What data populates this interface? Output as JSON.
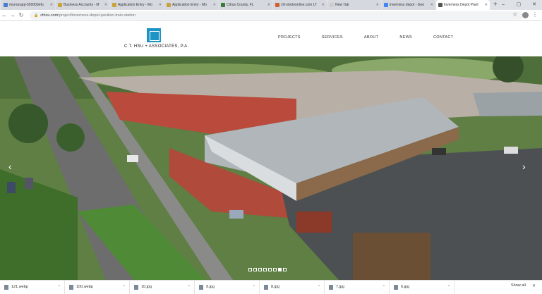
{
  "browser": {
    "tabs": [
      {
        "title": "munozapp-55000defu",
        "icon_color": "#4a7bd0",
        "active": false
      },
      {
        "title": "Business Accounts - M",
        "icon_color": "#c8a23a",
        "active": false
      },
      {
        "title": "Application Entry - Mo",
        "icon_color": "#c8a23a",
        "active": false
      },
      {
        "title": "Application Entry - Mo",
        "icon_color": "#c8a23a",
        "active": false
      },
      {
        "title": "Citrus County, FL",
        "icon_color": "#3a7a3a",
        "active": false
      },
      {
        "title": "chronicleonline.com LT",
        "icon_color": "#d06030",
        "active": false
      },
      {
        "title": "New Tab",
        "icon_color": "#cccccc",
        "active": false
      },
      {
        "title": "inverness depot - Goo",
        "icon_color": "#4285f4",
        "active": false
      },
      {
        "title": "Inverness Depot Pavil",
        "icon_color": "#555555",
        "active": true
      }
    ],
    "new_tab_symbol": "+",
    "window_controls": [
      "–",
      "▢",
      "✕"
    ],
    "url_domain": "cthsu.com",
    "url_path": "/project/inverness-depot-pavilion-train-station"
  },
  "site": {
    "brand_name": "C.T. HSU + ASSOCIATES, P.A.",
    "nav": [
      "PROJECTS",
      "SERVICES",
      "ABOUT",
      "NEWS",
      "CONTACT"
    ],
    "slider_dots": 8,
    "slider_active": 6,
    "icons": {
      "prev": "chevron-left-icon",
      "next": "chevron-right-icon"
    }
  },
  "downloads": {
    "items": [
      "121.webp",
      "100.webp",
      "10.jpg",
      "9.jpg",
      "8.jpg",
      "7.jpg",
      "6.jpg"
    ],
    "show_all": "Show all"
  }
}
